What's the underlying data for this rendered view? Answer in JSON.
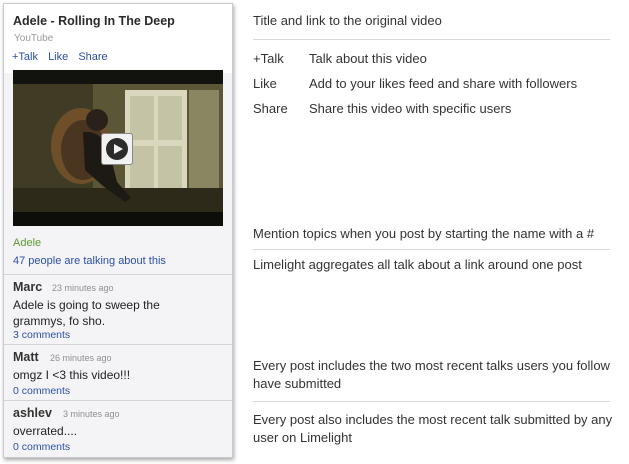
{
  "card": {
    "title": "Adele - Rolling In The Deep",
    "source": "YouTube",
    "actions": [
      "+Talk",
      "Like",
      "Share"
    ],
    "topic": "Adele",
    "talk_count": "47 people are talking about this",
    "posts": [
      {
        "author": "Marc",
        "time": "23 minutes ago",
        "message": "Adele is going to sweep the grammys, fo sho.",
        "comments": "3 comments"
      },
      {
        "author": "Matt",
        "time": "26 minutes ago",
        "message": "omgz I <3 this video!!!",
        "comments": "0 comments"
      },
      {
        "author": "ashlev",
        "time": "3 minutes ago",
        "message": "overrated....",
        "comments": "0 comments"
      }
    ]
  },
  "notes": {
    "title_link": "Title and link to the original video",
    "legend": [
      {
        "term": "+Talk",
        "desc": "Talk about this video"
      },
      {
        "term": "Like",
        "desc": "Add to your likes feed and share with followers"
      },
      {
        "term": "Share",
        "desc": "Share this video with specific users"
      }
    ],
    "mention": "Mention topics when you post by starting the name with a #",
    "aggregate": "Limelight aggregates all talk about a link around one post",
    "recent_follow": "Every post includes the two most recent talks users you follow have submitted",
    "recent_any": "Every post also includes the most recent talk submitted by any user on Limelight"
  },
  "colors": {
    "link": "#2c4fa8",
    "topic": "#5c9a34",
    "card_bg": "#f4f4f6"
  }
}
